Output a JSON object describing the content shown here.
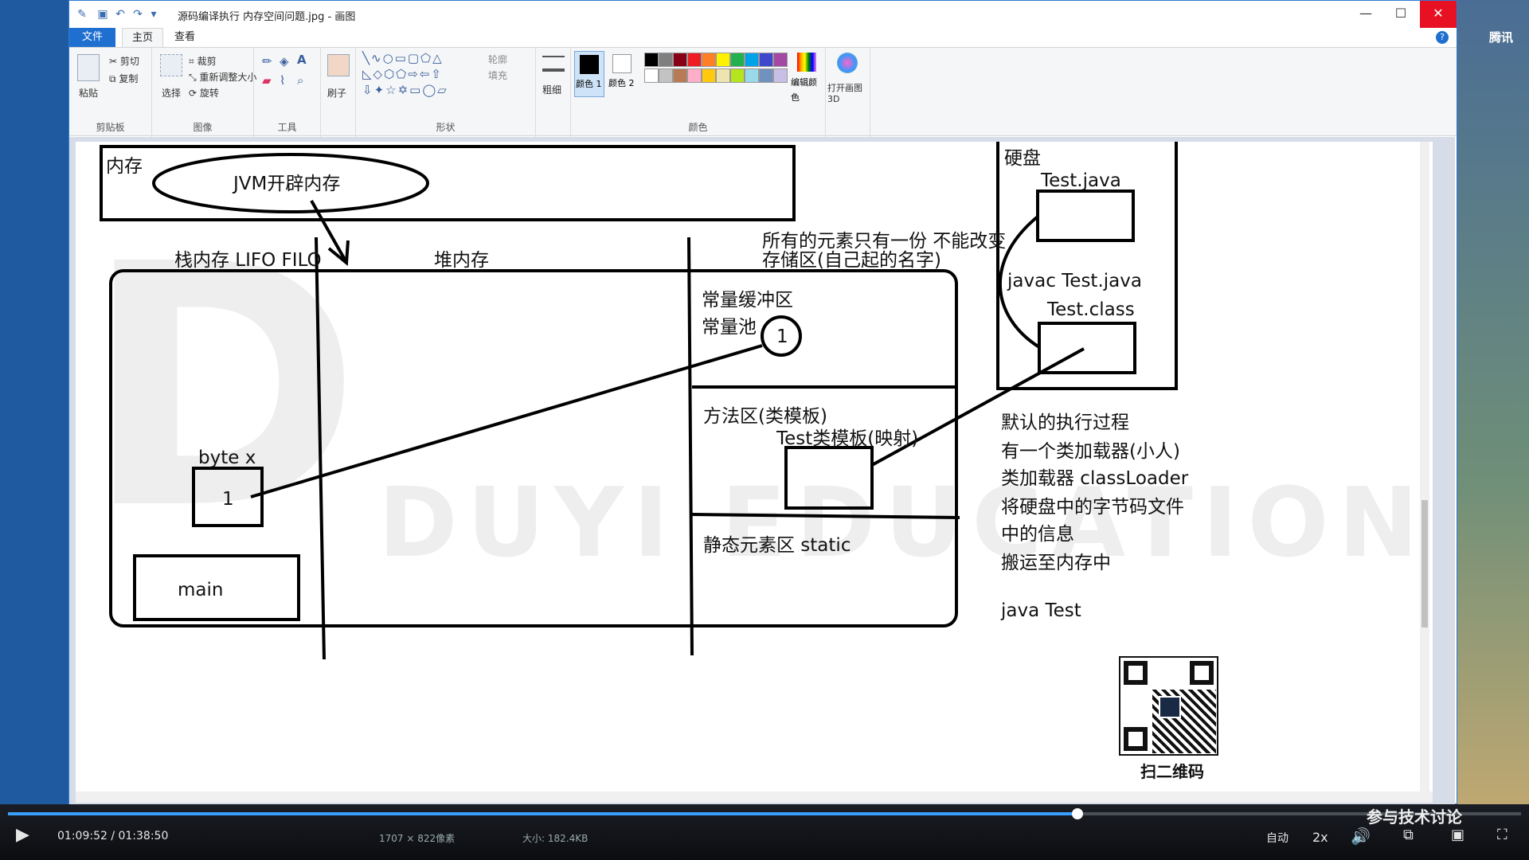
{
  "window": {
    "title": "源码编译执行 内存空间问题.jpg - 画图",
    "minimize": "—",
    "maximize": "☐",
    "close": "✕"
  },
  "ribbon": {
    "tabs": [
      "文件",
      "主页",
      "查看"
    ],
    "clipboard": {
      "paste": "粘贴",
      "cut": "剪切",
      "copy": "复制",
      "label": "剪贴板"
    },
    "image": {
      "select": "选择",
      "crop": "裁剪",
      "resize": "重新调整大小",
      "rotate": "旋转",
      "label": "图像"
    },
    "tools": {
      "label": "工具"
    },
    "brushes": {
      "label": "刷子"
    },
    "shapes": {
      "outline": "轮廓",
      "fill": "填充",
      "label": "形状"
    },
    "size": {
      "label": "粗细"
    },
    "colors": {
      "color1": "颜色 1",
      "color2": "颜色 2",
      "edit": "编辑颜色",
      "label": "颜色",
      "palette": [
        "#000000",
        "#7f7f7f",
        "#880015",
        "#ed1c24",
        "#ff7f27",
        "#fff200",
        "#22b14c",
        "#00a2e8",
        "#3f48cc",
        "#a349a4",
        "#ffffff",
        "#c3c3c3",
        "#b97a57",
        "#ffaec9",
        "#ffc90e",
        "#efe4b0",
        "#b5e61d",
        "#99d9ea",
        "#7092be",
        "#c8bfe7"
      ]
    },
    "paint3d": "打开画图 3D"
  },
  "diagram": {
    "memory_box_label": "内存",
    "jvm_label": "JVM开辟内存",
    "stack_label": "栈内存 LIFO FILO",
    "heap_label": "堆内存",
    "method_area_title_line1": "所有的元素只有一份 不能改变",
    "method_area_title_line2": "存储区(自己起的名字)",
    "constant_buffer": "常量缓冲区",
    "constant_pool": "常量池",
    "pool_value": "1",
    "method_area": "方法区(类模板)",
    "class_template": "Test类模板(映射)",
    "static_area": "静态元素区  static",
    "var_label": "byte  x",
    "var_value": "1",
    "main_label": "main",
    "disk_label": "硬盘",
    "java_file": "Test.java",
    "javac_cmd": "javac  Test.java",
    "class_file": "Test.class",
    "notes": [
      "默认的执行过程",
      "有一个类加载器(小人)",
      "类加载器 classLoader",
      "将硬盘中的字节码文件",
      "中的信息",
      "搬运至内存中"
    ],
    "run_cmd": "java  Test",
    "qr_label": "扫二维码",
    "watermark_text": "DUYI EDUCATION"
  },
  "status": {
    "dimensions": "1707 × 822像素",
    "size": "大小: 182.4KB"
  },
  "player": {
    "time": "01:09:52 / 01:38:50",
    "progress": 0.707,
    "auto": "自动",
    "speed": "2x",
    "promo_line1": "参与技术讨论"
  },
  "desktop": {
    "right_text": "腾讯"
  }
}
